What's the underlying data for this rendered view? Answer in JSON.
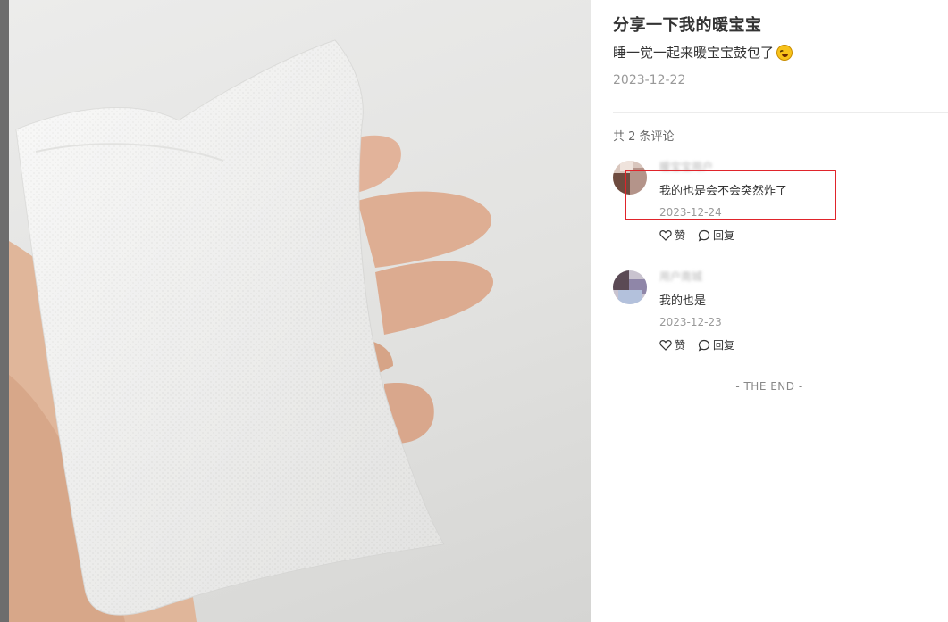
{
  "note": {
    "title": "分享一下我的暖宝宝",
    "description": "睡一觉一起来暖宝宝鼓包了",
    "emoji": "rofl-emoji",
    "date": "2023-12-22"
  },
  "comments_section": {
    "count_label": "共 2 条评论",
    "comments": [
      {
        "author": "暖宝宝用户",
        "text": "我的也是会不会突然炸了",
        "date": "2023-12-24",
        "like_label": "赞",
        "reply_label": "回复",
        "highlighted": true
      },
      {
        "author": "用户南城",
        "text": "我的也是",
        "date": "2023-12-23",
        "like_label": "赞",
        "reply_label": "回复",
        "highlighted": false
      }
    ],
    "end_label": "- THE END -"
  },
  "colors": {
    "highlight_box": "#e0242b",
    "muted_text": "#999999"
  }
}
